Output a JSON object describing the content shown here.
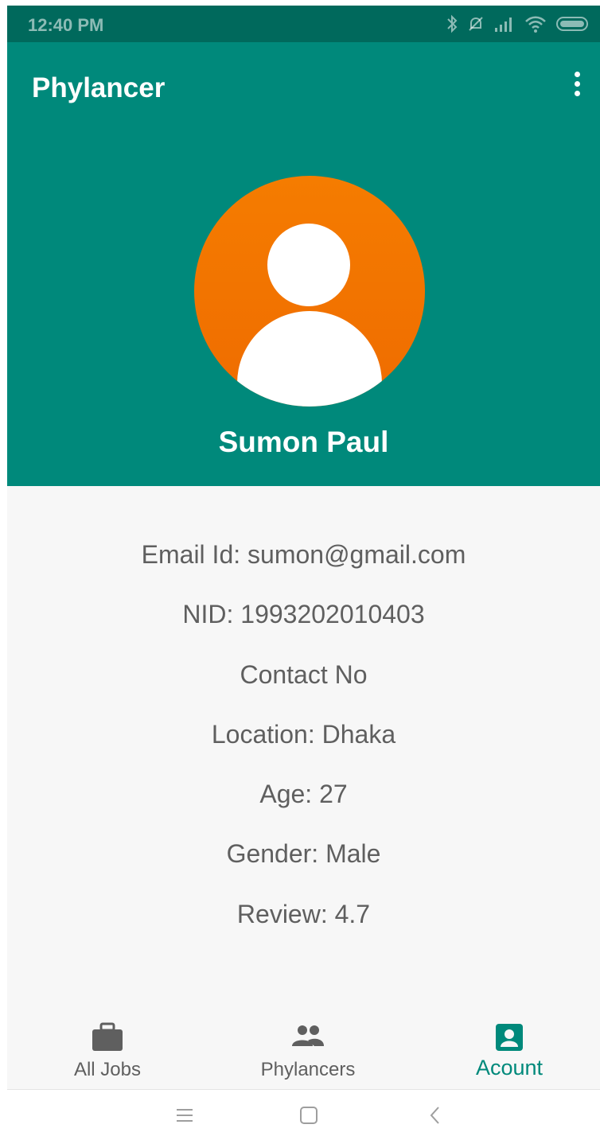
{
  "status_bar": {
    "time": "12:40 PM",
    "icons": [
      "bluetooth-icon",
      "bell-off-icon",
      "signal-icon",
      "wifi-icon",
      "battery-icon"
    ]
  },
  "app_bar": {
    "title": "Phylancer",
    "menu_icon": "more-vert-icon"
  },
  "profile": {
    "avatar_icon": "person-icon",
    "name": "Sumon Paul"
  },
  "details": [
    {
      "key": "email",
      "text": "Email Id: sumon@gmail.com"
    },
    {
      "key": "nid",
      "text": "NID: 1993202010403"
    },
    {
      "key": "contact",
      "text": "Contact No"
    },
    {
      "key": "location",
      "text": "Location: Dhaka"
    },
    {
      "key": "age",
      "text": "Age: 27"
    },
    {
      "key": "gender",
      "text": "Gender: Male"
    },
    {
      "key": "review",
      "text": "Review: 4.7"
    }
  ],
  "bottom_nav": {
    "items": [
      {
        "label": "All Jobs",
        "icon": "briefcase-icon",
        "active": false
      },
      {
        "label": "Phylancers",
        "icon": "people-icon",
        "active": false
      },
      {
        "label": "Acount",
        "icon": "account-box-icon",
        "active": true
      }
    ]
  },
  "system_nav": {
    "buttons": [
      "menu-icon",
      "home-icon",
      "back-icon"
    ]
  },
  "colors": {
    "primary": "#00897b",
    "primary_dark": "#00695c",
    "avatar": "#f57c00",
    "text_secondary": "#5f5f5f",
    "background": "#f7f7f7"
  }
}
